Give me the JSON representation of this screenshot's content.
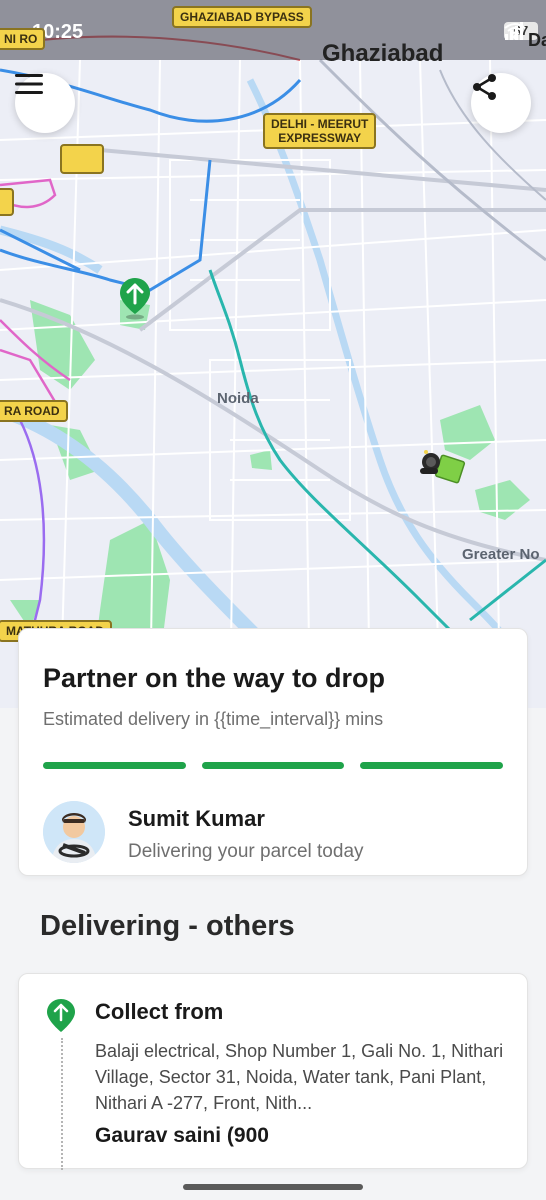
{
  "status_bar": {
    "time": "10:25",
    "battery": "67",
    "icons": [
      "wifi-icon",
      "signal-icon",
      "signal-icon",
      "battery-icon"
    ]
  },
  "map": {
    "city": "Ghaziabad",
    "road_labels": {
      "bypass": "GHAZIABAD BYPASS",
      "expressway_line1": "DELHI - MEERUT",
      "expressway_line2": "EXPRESSWAY",
      "ni_road": "NI RO",
      "ra_road": "RA ROAD",
      "mathura_road": "MATHURA ROAD",
      "edge_label_1": "D",
      "edge_label_2": "Da"
    },
    "place_labels": {
      "noida": "Noida",
      "greater_noida": "Greater No"
    },
    "colors": {
      "road_tag": "#f3d34b",
      "park": "#9ee5b2",
      "river": "#b9d9f4",
      "route_teal": "#29b6ad",
      "metro_blue": "#3b8ee6",
      "metro_pink": "#e066c8",
      "metro_purple": "#9a6cf0",
      "pickup_pin": "#1fa34a"
    }
  },
  "buttons": {
    "menu_icon": "hamburger-menu-icon",
    "share_icon": "share-icon"
  },
  "status_card": {
    "title": "Partner on the way to drop",
    "subtitle": "Estimated delivery in {{time_interval}} mins",
    "progress_segments_complete": 3,
    "progress_segments_total": 3,
    "partner_name": "Sumit Kumar",
    "partner_status": "Delivering your parcel today"
  },
  "section": {
    "title": "Delivering - others"
  },
  "pickup": {
    "title": "Collect from",
    "address": "Balaji electrical, Shop Number 1, Gali No. 1, Nithari Village, Sector 31, Noida, Water tank, Pani Plant, Nithari A -277, Front, Nith...",
    "contact": "Gaurav saini (900",
    "pin_icon": "pickup-pin-icon"
  }
}
